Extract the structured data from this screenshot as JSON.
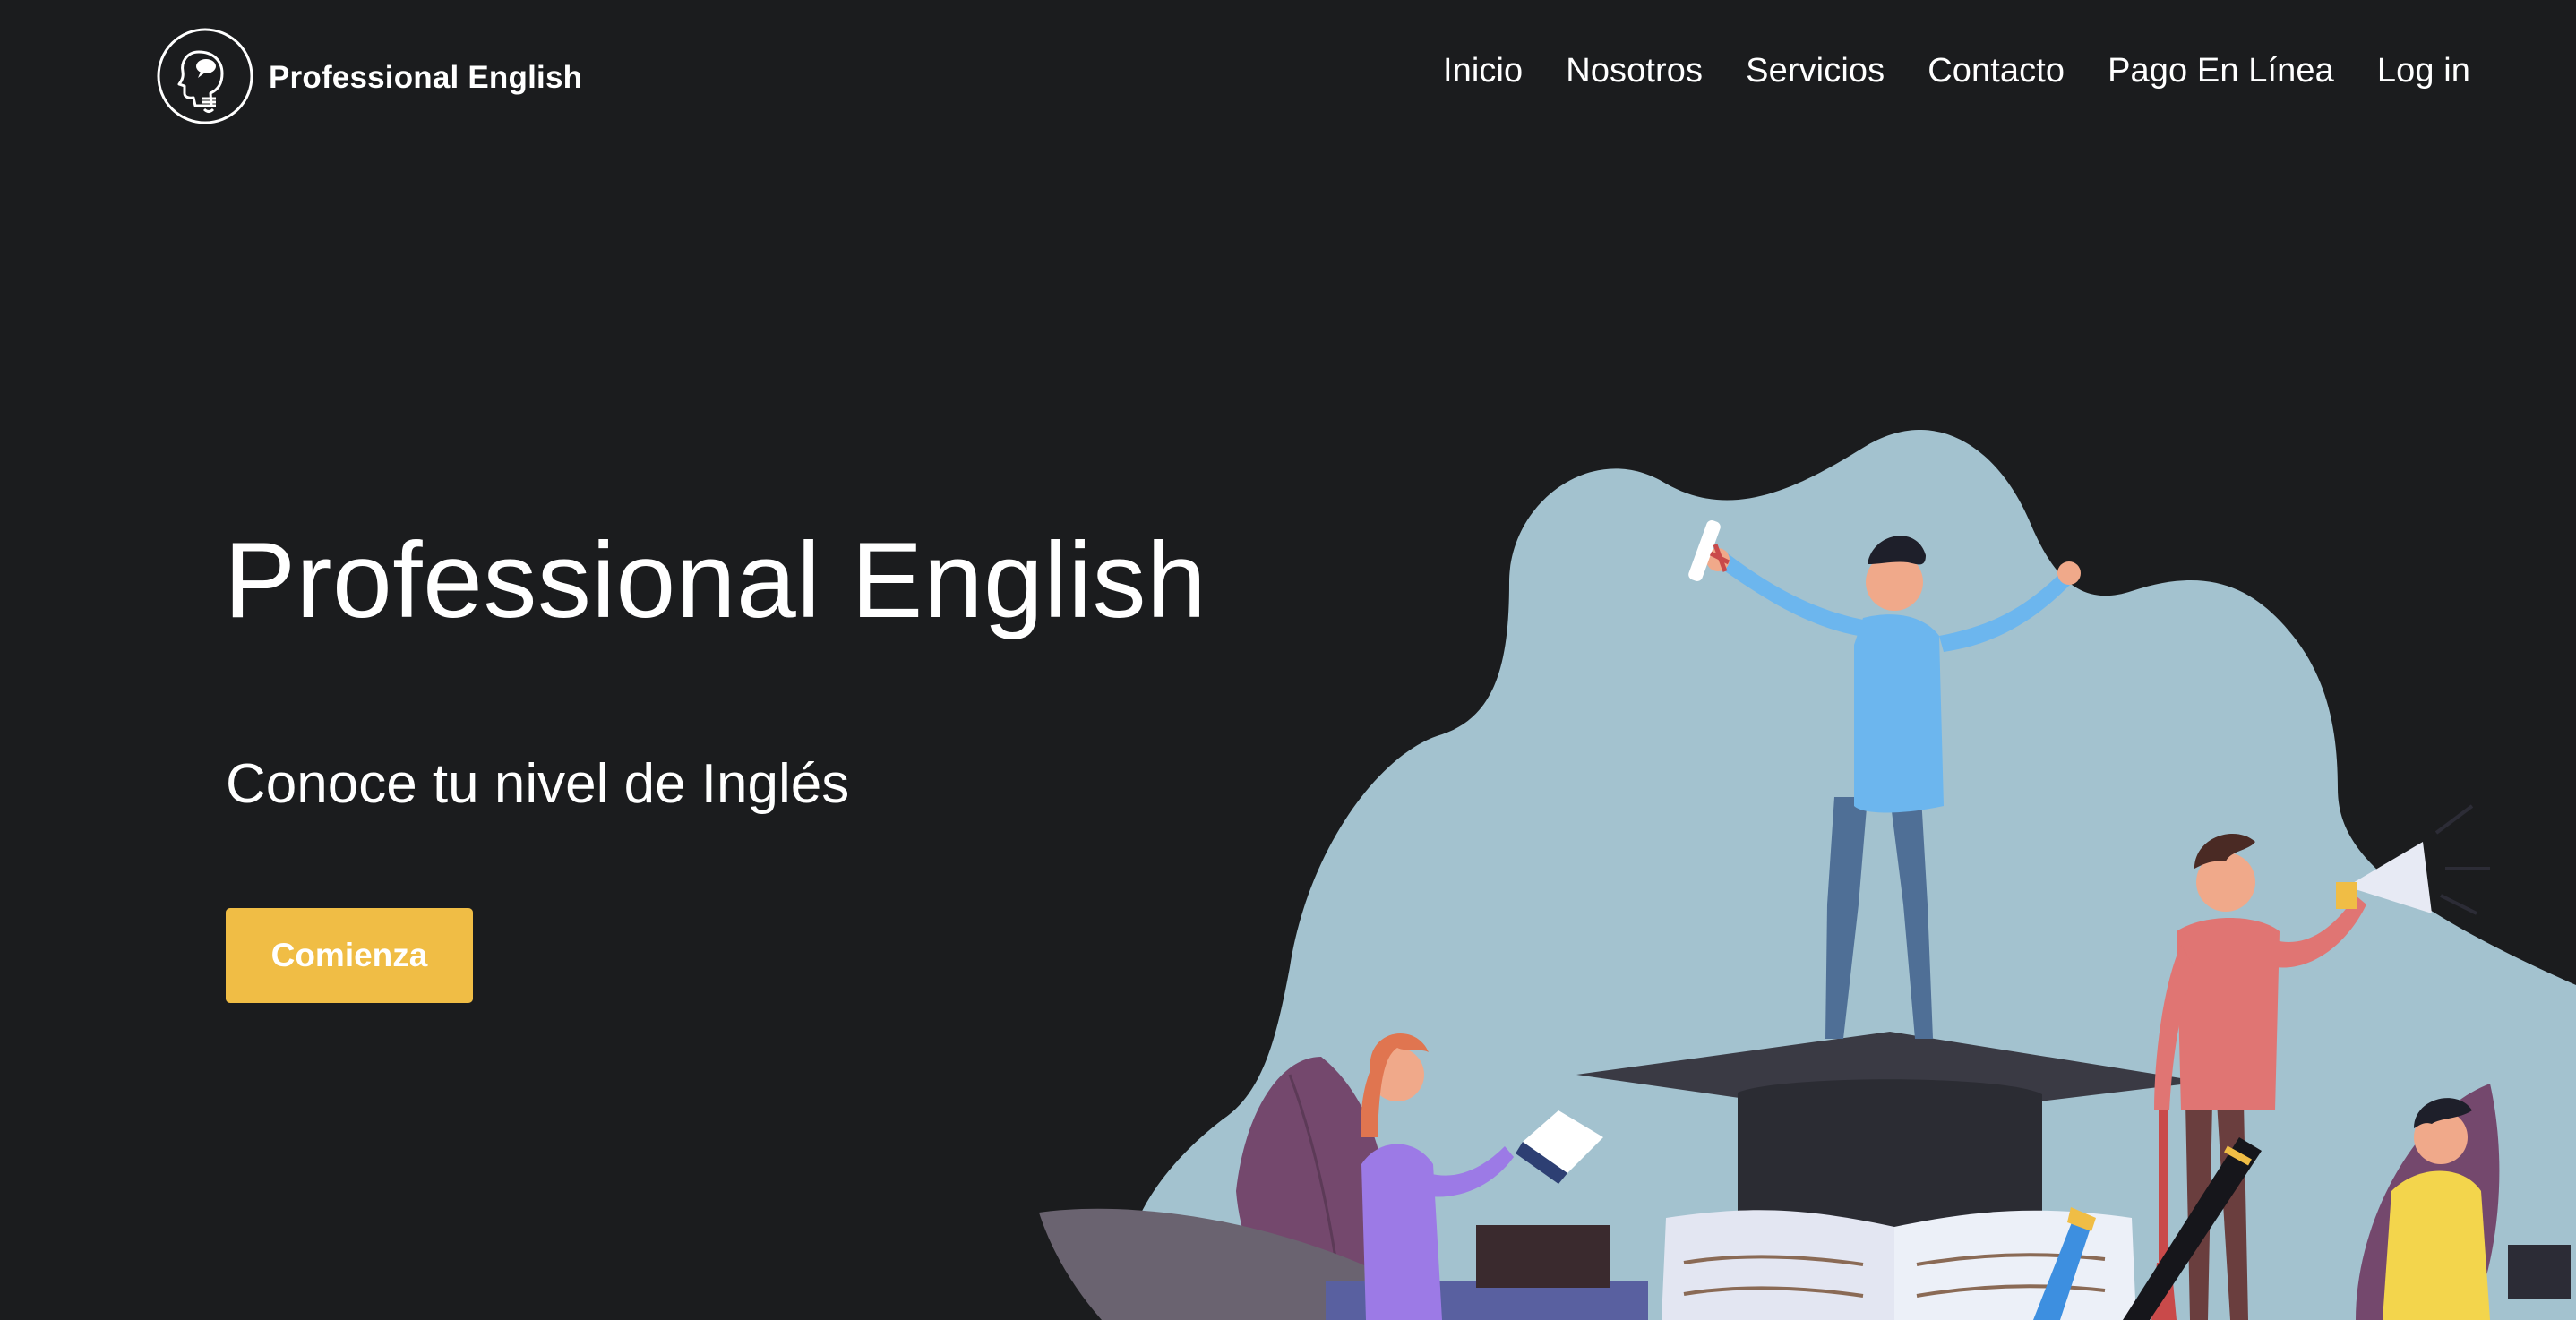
{
  "brand": {
    "name": "Professional English",
    "logo_icon": "head-speech-bubble-logo-icon"
  },
  "nav": {
    "items": [
      {
        "label": "Inicio"
      },
      {
        "label": "Nosotros"
      },
      {
        "label": "Servicios"
      },
      {
        "label": "Contacto"
      },
      {
        "label": "Pago En Línea"
      },
      {
        "label": "Log in"
      }
    ]
  },
  "hero": {
    "title": "Professional English",
    "subtitle": "Conoce tu nivel de Inglés",
    "cta_label": "Comienza",
    "illustration_icon": "graduation-students-illustration"
  },
  "colors": {
    "background": "#1b1c1e",
    "accent": "#f0bd45",
    "text": "#ffffff",
    "blob": "#a3c2cf"
  }
}
